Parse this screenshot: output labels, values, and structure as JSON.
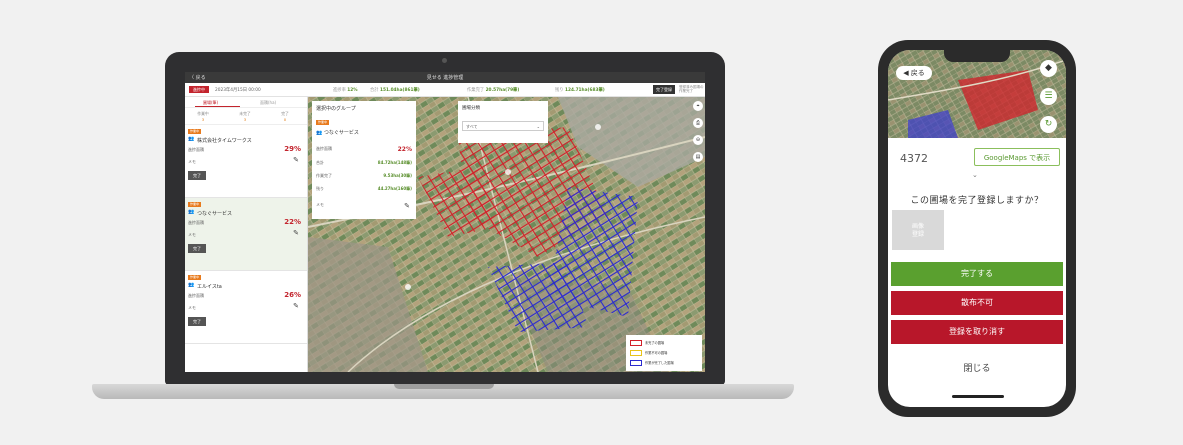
{
  "laptop": {
    "app": {
      "back": "〈 戻る",
      "title": "見せる 進捗管理"
    },
    "bar": {
      "badge": "進捗中",
      "date": "2023年4月15日 00:00",
      "stats": [
        {
          "label": "進捗率",
          "value": "12%"
        },
        {
          "label": "合計",
          "value": "151.04ha(861筆)"
        },
        {
          "label": "作業完了",
          "value": "20.57ha(79筆)"
        },
        {
          "label": "残り",
          "value": "124.71ha(683筆)"
        }
      ],
      "button": "完了登録",
      "note": "登録済み圃場の作業完了"
    },
    "list": {
      "tabs": [
        "圃場(筆)",
        "面積(ha)"
      ],
      "counts": [
        {
          "label": "作業中",
          "value": "3"
        },
        {
          "label": "未完了",
          "value": "3"
        },
        {
          "label": "完了",
          "value": "0"
        }
      ],
      "cards": [
        {
          "tag": "作業中",
          "name": "株式会社タイムワークス",
          "label": "進捗面積",
          "pct": "29%",
          "memo": "メモ",
          "done": "完了"
        },
        {
          "tag": "作業中",
          "name": "つなぐサービス",
          "label": "進捗面積",
          "pct": "22%",
          "memo": "メモ",
          "done": "完了"
        },
        {
          "tag": "作業中",
          "name": "エルイスta",
          "label": "進捗面積",
          "pct": "26%",
          "memo": "メモ",
          "done": "完了"
        }
      ]
    },
    "group_panel": {
      "header": "選択中のグループ",
      "tag": "作業中",
      "name": "つなぐサービス",
      "rows": [
        {
          "label": "進捗面積",
          "value": "22%"
        },
        {
          "label": "合計",
          "value": "84.72ha(148筆)"
        },
        {
          "label": "作業完了",
          "value": "9.53ha(30筆)"
        },
        {
          "label": "残り",
          "value": "44.27ha(160筆)"
        }
      ],
      "memo": "メモ"
    },
    "class_panel": {
      "header": "圃場分類",
      "select": "すべて"
    },
    "tools": [
      "⌖",
      "⎙",
      "⊖",
      "▤"
    ],
    "legend": [
      {
        "label": "未完了の圃場",
        "color": "#d2202a"
      },
      {
        "label": "作業不可の圃場",
        "color": "#e8c31a"
      },
      {
        "label": "作業が完了した圃場",
        "color": "#2a2ad0"
      }
    ]
  },
  "phone": {
    "back": "◀ 戻る",
    "field_id": "4372",
    "google_maps": "GoogleMaps で表示",
    "question": "この圃場を完了登録しますか？",
    "photo": "画像\n登録",
    "buttons": [
      {
        "label": "完了する",
        "color": "#5aa02f"
      },
      {
        "label": "散布不可",
        "color": "#b8172a"
      },
      {
        "label": "登録を取り消す",
        "color": "#b8172a"
      }
    ],
    "close": "閉じる"
  }
}
